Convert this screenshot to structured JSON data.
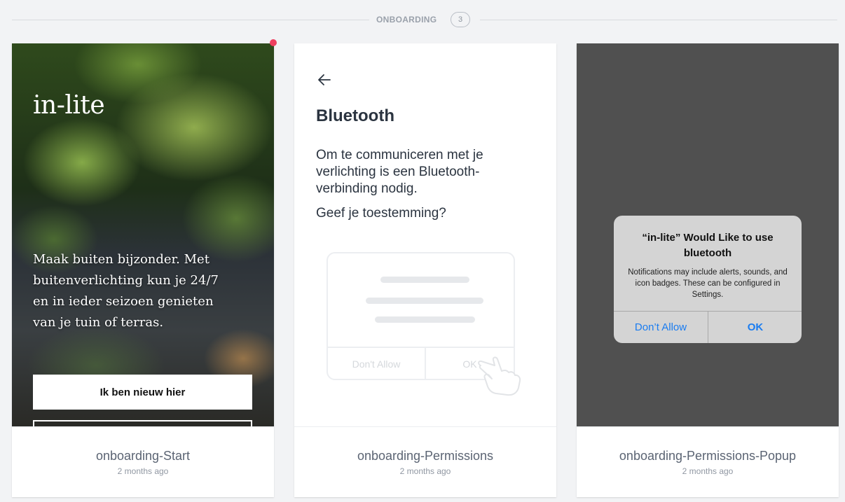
{
  "section": {
    "title": "ONBOARDING",
    "count": "3"
  },
  "cards": [
    {
      "name": "onboarding-Start",
      "time": "2 months ago",
      "screen": {
        "logo": "in-lite",
        "headline": "Maak buiten bijzonder. Met buitenverlichting kun je 24/7 en in ieder seizoen genieten van je tuin of terras.",
        "cta": "Ik ben nieuw hier"
      }
    },
    {
      "name": "onboarding-Permissions",
      "time": "2 months ago",
      "screen": {
        "title": "Bluetooth",
        "body": "Om te communiceren met je verlichting is een Bluetooth-verbinding nodig.",
        "question": "Geef je toestemming?",
        "illus_deny": "Don't Allow",
        "illus_ok": "OK"
      }
    },
    {
      "name": "onboarding-Permissions-Popup",
      "time": "2 months ago",
      "screen": {
        "alert_title": "“in-lite” Would Like to use bluetooth",
        "alert_message": "Notifications may include alerts, sounds, and icon badges. These can be configured in Settings.",
        "deny": "Don’t Allow",
        "ok": "OK"
      }
    }
  ],
  "colors": {
    "background": "#f2f3f5",
    "notification_dot": "#ee3f5f",
    "ios_blue": "#1a7cf0"
  }
}
